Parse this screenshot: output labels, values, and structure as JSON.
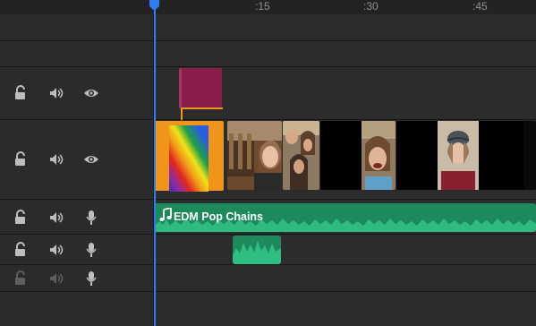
{
  "ruler": {
    "ticks": [
      ":15",
      ":30",
      ":45"
    ]
  },
  "tracks": [
    {
      "kind": "spacer"
    },
    {
      "kind": "spacer"
    },
    {
      "kind": "title",
      "controls": [
        "lock-open-icon",
        "speaker-icon",
        "eye-icon"
      ]
    },
    {
      "kind": "video",
      "controls": [
        "lock-open-icon",
        "speaker-icon",
        "eye-icon"
      ]
    },
    {
      "kind": "audio",
      "controls": [
        "lock-open-icon",
        "speaker-icon",
        "microphone-icon"
      ]
    },
    {
      "kind": "audio",
      "controls": [
        "lock-open-icon",
        "speaker-icon",
        "microphone-icon"
      ]
    },
    {
      "kind": "audio",
      "controls": [
        "lock-open-icon",
        "speaker-icon",
        "microphone-icon"
      ],
      "disabled": true
    }
  ],
  "audio_clip": {
    "title": "EDM Pop Chains"
  },
  "colors": {
    "selection": "#f0951a",
    "title_clip": "#8a1e4a",
    "audio": "#1d8a5c",
    "playhead": "#2d7cf0"
  }
}
